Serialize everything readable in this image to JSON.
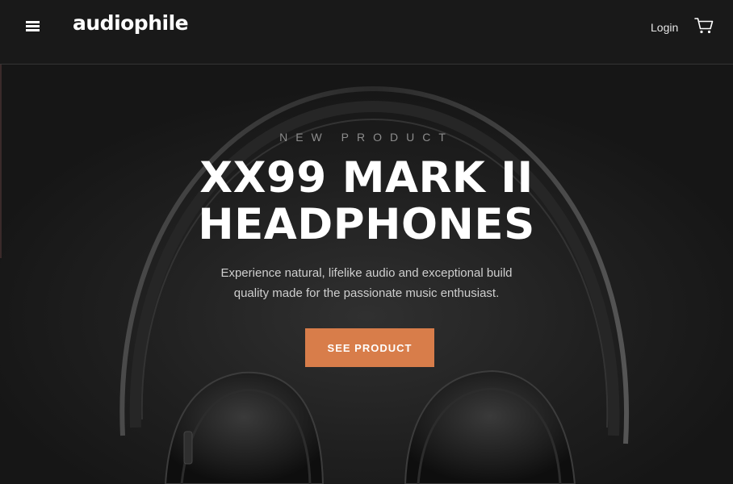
{
  "header": {
    "logo": "audiophile",
    "login_label": "Login",
    "menu_icon": "hamburger-menu-icon",
    "cart_icon": "cart-icon"
  },
  "hero": {
    "overline": "NEW PRODUCT",
    "title_line1": "XX99 MARK II",
    "title_line2": "HEADPHONES",
    "description_line1": "Experience natural, lifelike audio and exceptional build",
    "description_line2": "quality made for the passionate music enthusiast.",
    "cta_label": "SEE PRODUCT"
  },
  "colors": {
    "background": "#191919",
    "accent": "#d87d4a",
    "text": "#ffffff",
    "muted": "#8c8c8c"
  }
}
